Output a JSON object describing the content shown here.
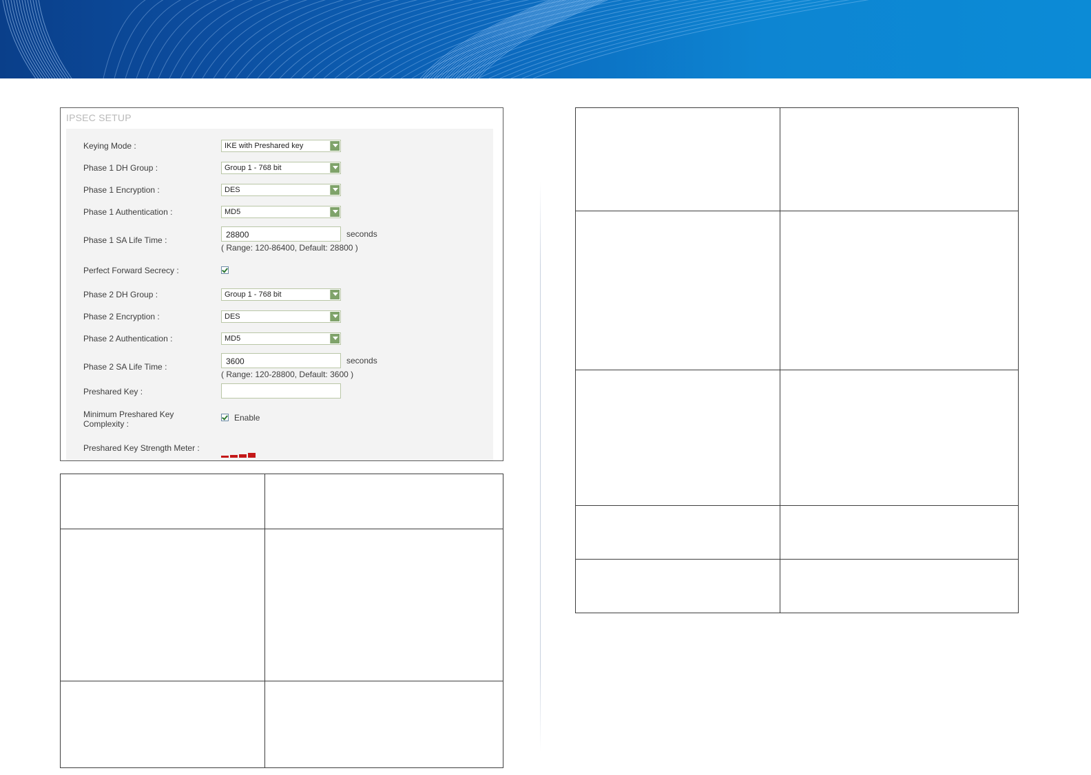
{
  "panel": {
    "title": "IPSEC SETUP",
    "rows": {
      "keying_mode": {
        "label": "Keying Mode :",
        "value": "IKE with Preshared key"
      },
      "phase1_dh": {
        "label": "Phase 1 DH Group :",
        "value": "Group 1 - 768 bit"
      },
      "phase1_enc": {
        "label": "Phase 1 Encryption :",
        "value": "DES"
      },
      "phase1_auth": {
        "label": "Phase 1 Authentication :",
        "value": "MD5"
      },
      "phase1_sa": {
        "label": "Phase 1 SA Life Time :",
        "value": "28800",
        "unit": "seconds",
        "hint": "( Range: 120-86400, Default: 28800 )"
      },
      "pfs": {
        "label": "Perfect Forward Secrecy :",
        "checked": true
      },
      "phase2_dh": {
        "label": "Phase 2 DH Group :",
        "value": "Group 1 - 768 bit"
      },
      "phase2_enc": {
        "label": "Phase 2 Encryption :",
        "value": "DES"
      },
      "phase2_auth": {
        "label": "Phase 2 Authentication :",
        "value": "MD5"
      },
      "phase2_sa": {
        "label": "Phase 2 SA Life Time :",
        "value": "3600",
        "unit": "seconds",
        "hint": "( Range: 120-28800, Default: 3600 )"
      },
      "psk": {
        "label": "Preshared Key :",
        "value": ""
      },
      "min_complexity": {
        "label_line1": "Minimum Preshared Key",
        "label_line2": "Complexity :",
        "checked": true,
        "checkbox_label": "Enable"
      },
      "strength_meter": {
        "label": "Preshared Key Strength Meter :",
        "level": 4,
        "color": "#c41818"
      }
    }
  },
  "colors": {
    "banner_dark": "#0a3f8a",
    "banner_light": "#0c8bd6",
    "table_border": "#3e3e3e"
  }
}
